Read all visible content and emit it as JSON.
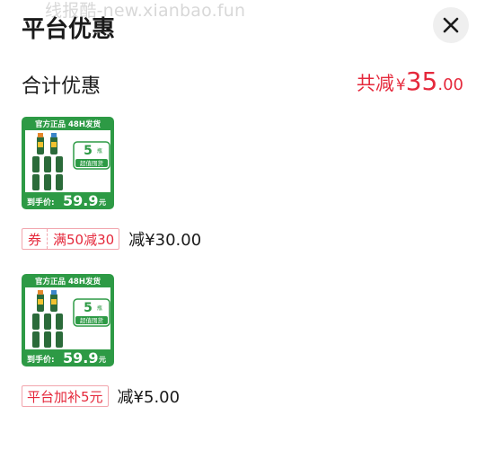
{
  "watermark": "线报酷-new.xianbao.fun",
  "header": {
    "title": "平台优惠"
  },
  "summary": {
    "label": "合计优惠",
    "amount_prefix": "共减",
    "currency": "¥",
    "amount_int": "35",
    "amount_dec": ".00"
  },
  "items": [
    {
      "image": {
        "banner": "官方正品 48H发货",
        "badge_num": "5",
        "badge_unit": "瓶",
        "badge_text": "超值囤货",
        "price_label": "到手价:",
        "price": "59.9",
        "price_unit": "元"
      },
      "coupon_kind": "券",
      "coupon_desc": "满50减30",
      "minus": "减¥30.00"
    },
    {
      "image": {
        "banner": "官方正品 48H发货",
        "badge_num": "5",
        "badge_unit": "瓶",
        "badge_text": "超值囤货",
        "price_label": "到手价:",
        "price": "59.9",
        "price_unit": "元"
      },
      "tag": "平台加补5元",
      "minus": "减¥5.00"
    }
  ],
  "colors": {
    "accent_red": "#e5293c",
    "tag_border": "#f2a5ad",
    "product_green": "#2d9a45"
  },
  "icons": {
    "close": "close-icon"
  }
}
